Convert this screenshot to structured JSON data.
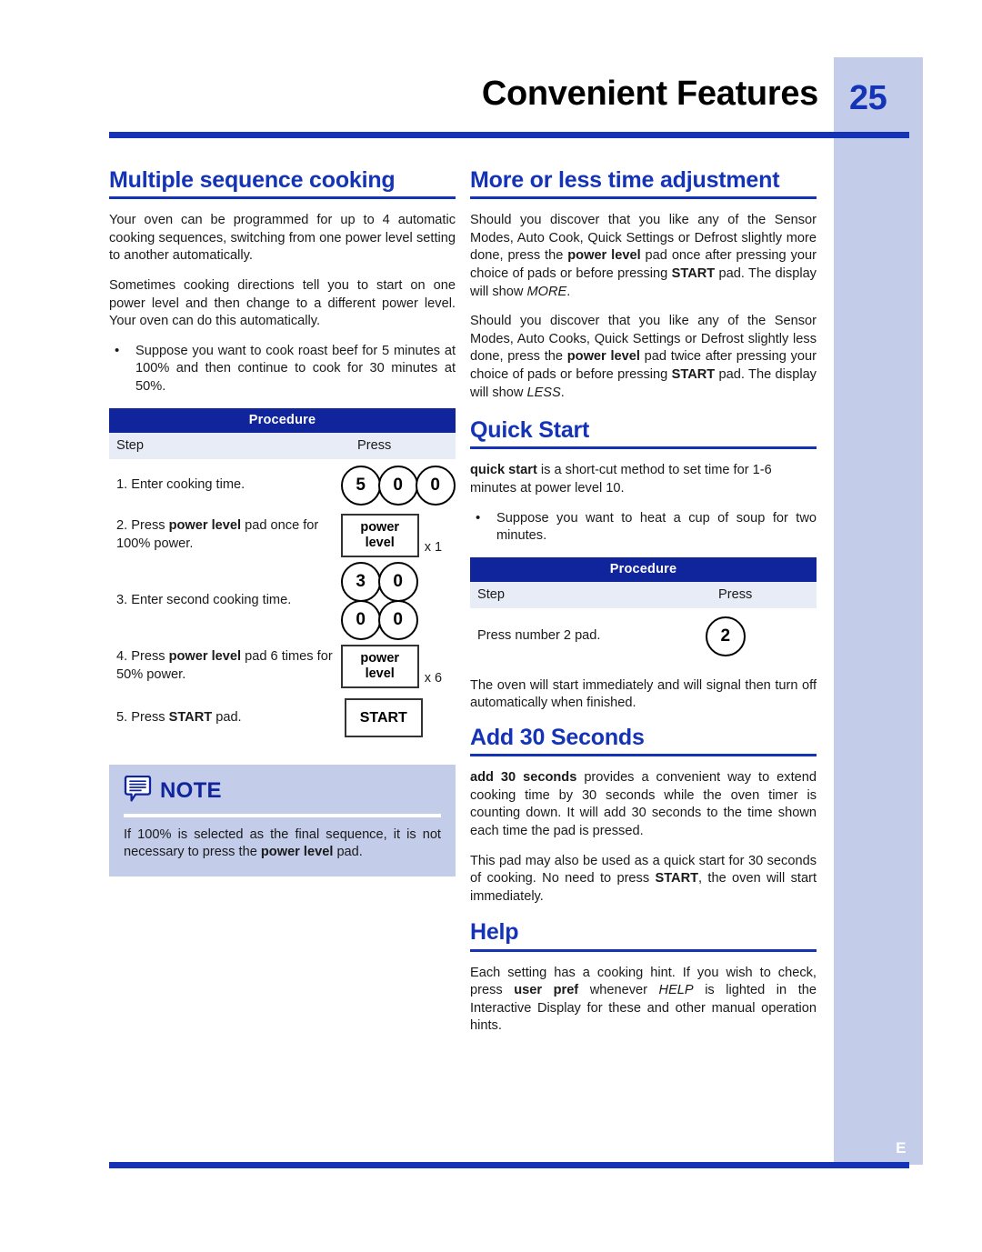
{
  "header": {
    "title": "Convenient Features",
    "page_number": "25",
    "side_letter": "E",
    "accent_color": "#1433b6",
    "sidebar_color": "#c3cde9"
  },
  "left_column": {
    "section1": {
      "heading": "Multiple sequence cooking",
      "paragraphs": [
        "Your oven can be programmed for up to 4 automatic cooking sequences, switching from one power level setting to another automatically.",
        "Sometimes cooking directions tell you to start on one power level and then change to a different power level. Your oven can do this automatically."
      ],
      "bullets": [
        "Suppose you want to cook roast beef for 5 minutes at 100% and then continue to cook for 30 minutes at 50%."
      ],
      "procedure": {
        "title": "Procedure",
        "col_step": "Step",
        "col_press": "Press",
        "rows": [
          {
            "step_prefix": "1.",
            "step_text": "Enter cooking time.",
            "press_type": "circles",
            "keys": [
              "5",
              "0",
              "0"
            ]
          },
          {
            "step_prefix": "2.",
            "step_text_pre": "Press ",
            "step_text_bold": "power level",
            "step_text_post": " pad once for 100% power.",
            "press_type": "pad",
            "pad_line1": "power",
            "pad_line2": "level",
            "multiplier": "x 1"
          },
          {
            "step_prefix": "3.",
            "step_text": "Enter second cooking time.",
            "press_type": "circles-stacked",
            "keys_row1": [
              "3",
              "0"
            ],
            "keys_row2": [
              "0",
              "0"
            ]
          },
          {
            "step_prefix": "4.",
            "step_text_pre": "Press ",
            "step_text_bold": "power level",
            "step_text_post": " pad 6 times for 50% power.",
            "press_type": "pad",
            "pad_line1": "power",
            "pad_line2": "level",
            "multiplier": "x 6"
          },
          {
            "step_prefix": "5.",
            "step_text_pre": "Press ",
            "step_text_bold": "START",
            "step_text_post": " pad.",
            "press_type": "start",
            "pad_label": "START"
          }
        ]
      }
    },
    "note": {
      "title": "NOTE",
      "text_pre": "If 100% is selected as the final sequence, it is not necessary to press the ",
      "text_bold": "power level",
      "text_post": " pad."
    }
  },
  "right_column": {
    "section_more_less": {
      "heading": "More or less time adjustment",
      "para1_a": "Should you discover that you like any of the Sensor Modes, Auto Cook, Quick Settings or Defrost slightly more done, press the ",
      "para1_bold1": "power level",
      "para1_b": " pad once after pressing your choice of pads or before pressing ",
      "para1_bold2": "START",
      "para1_c": " pad. The display will show ",
      "para1_italic": "MORE",
      "para1_d": ".",
      "para2_a": "Should you discover that you like any of the Sensor Modes, Auto Cooks, Quick Settings or Defrost slightly less done, press the ",
      "para2_bold1": "power level",
      "para2_b": " pad twice after pressing your choice of pads or before pressing ",
      "para2_bold2": "START",
      "para2_c": " pad. The display will show ",
      "para2_italic": "LESS",
      "para2_d": "."
    },
    "section_quick_start": {
      "heading": "Quick Start",
      "para_bold": "quick start",
      "para_rest": " is a short-cut method to set time for 1-6 minutes at power level 10.",
      "bullets": [
        "Suppose you want to heat a cup of soup for two minutes."
      ],
      "procedure": {
        "title": "Procedure",
        "col_step": "Step",
        "col_press": "Press",
        "rows": [
          {
            "step_text": "Press number 2 pad.",
            "press_type": "circles",
            "keys": [
              "2"
            ]
          }
        ]
      },
      "after_text": "The oven will start immediately and will signal then turn off automatically when finished."
    },
    "section_add_30": {
      "heading": "Add 30 Seconds",
      "para1_bold": "add 30 seconds",
      "para1_rest": " provides a convenient way to extend cooking time by 30 seconds while the oven timer is counting down. It will add 30 seconds to the time shown each time the pad is pressed.",
      "para2_a": "This pad may also be used as a quick start for 30 seconds of cooking. No need to press ",
      "para2_bold": "START",
      "para2_b": ", the oven will start immediately."
    },
    "section_help": {
      "heading": "Help",
      "para_a": "Each setting has a cooking hint. If you wish to check, press ",
      "para_bold": "user pref",
      "para_b": " whenever ",
      "para_italic": "HELP",
      "para_c": " is lighted in the Interactive Display for these and other manual operation hints."
    }
  }
}
